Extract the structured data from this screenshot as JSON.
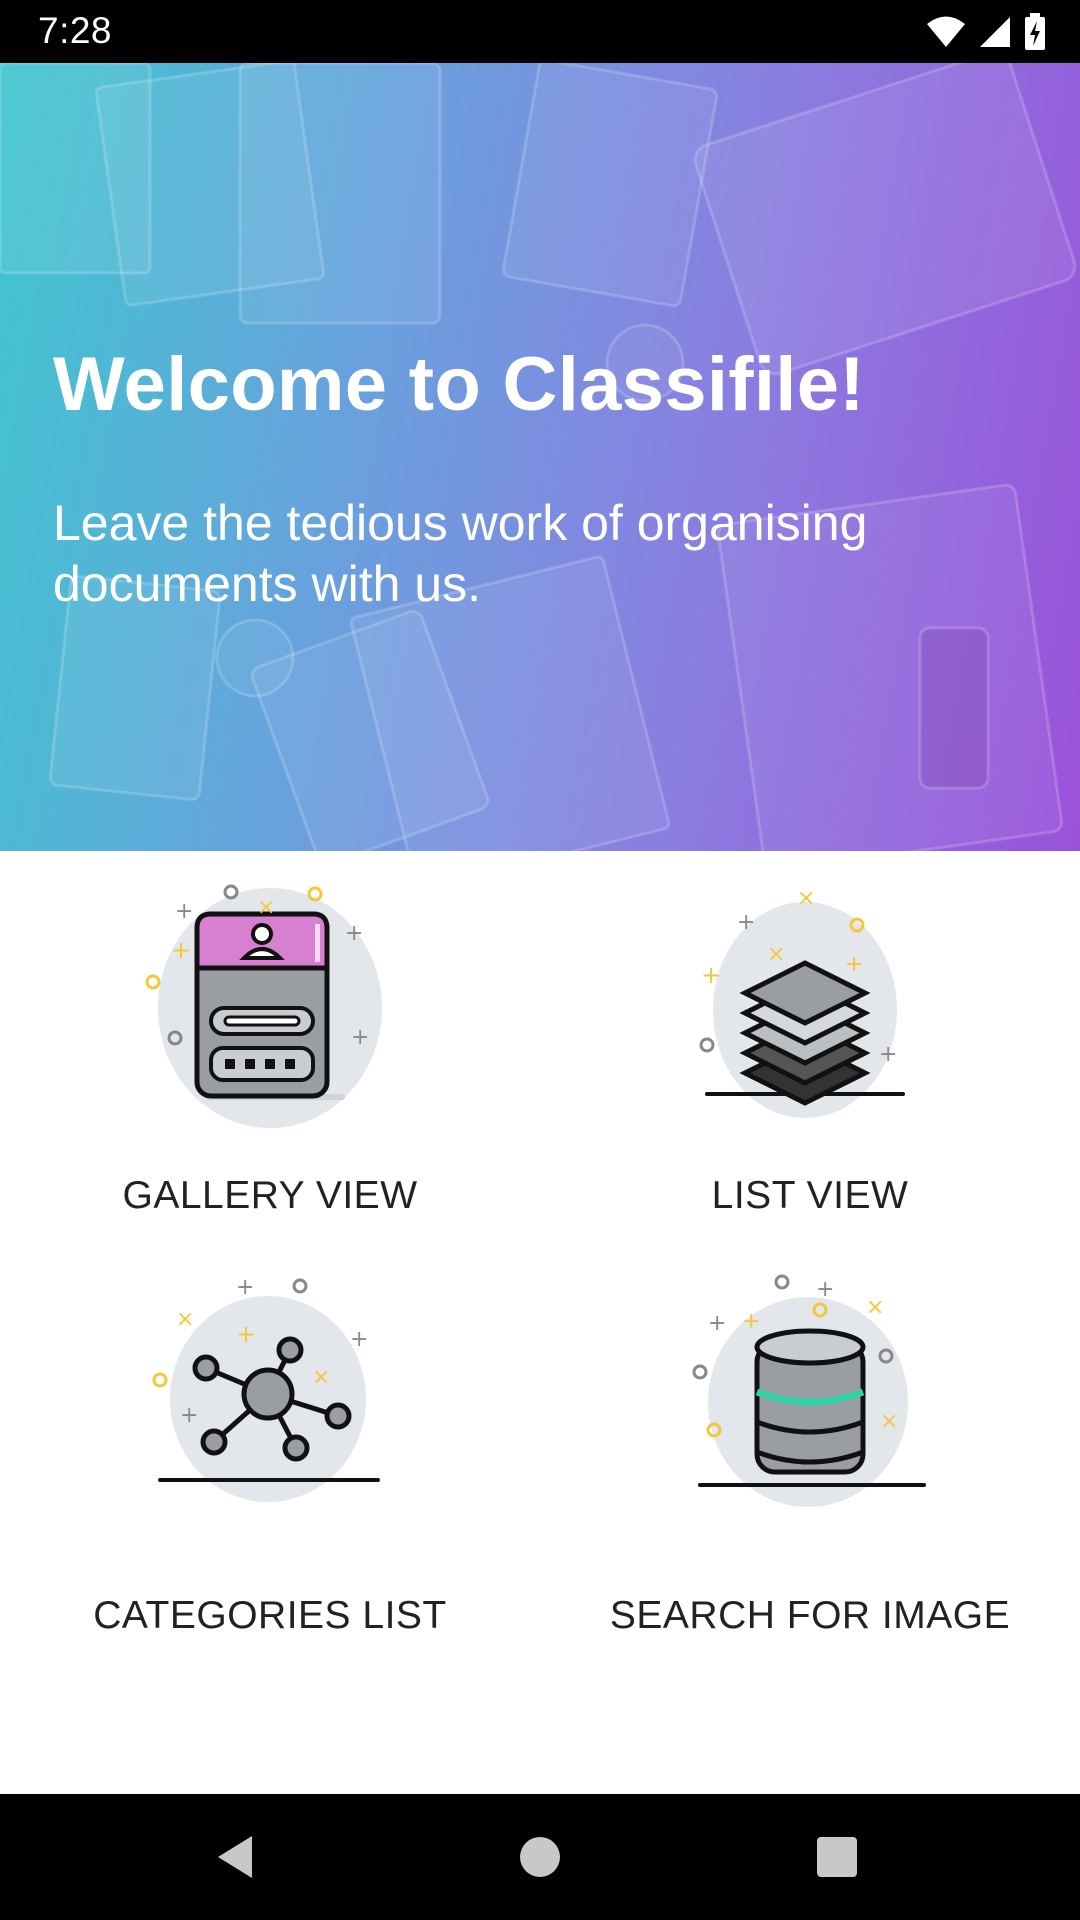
{
  "status_bar": {
    "time": "7:28",
    "icons": [
      "wifi-icon",
      "signal-icon",
      "battery-charging-icon"
    ]
  },
  "hero": {
    "title": "Welcome to Classifile!",
    "subtitle": "Leave the tedious work of organising documents with us."
  },
  "tiles": [
    {
      "label": "GALLERY VIEW",
      "icon": "id-card-icon"
    },
    {
      "label": "LIST VIEW",
      "icon": "layers-icon"
    },
    {
      "label": "CATEGORIES LIST",
      "icon": "network-nodes-icon"
    },
    {
      "label": "SEARCH FOR IMAGE",
      "icon": "database-icon"
    }
  ],
  "nav_bar": {
    "buttons": [
      "back-icon",
      "home-icon",
      "recents-icon"
    ]
  },
  "colors": {
    "hero_gradient_start": "#3fc6cf",
    "hero_gradient_end": "#9a52d9",
    "accent_pink": "#d77fd1",
    "accent_yellow": "#f5c73c",
    "accent_teal": "#2fd3a7"
  }
}
